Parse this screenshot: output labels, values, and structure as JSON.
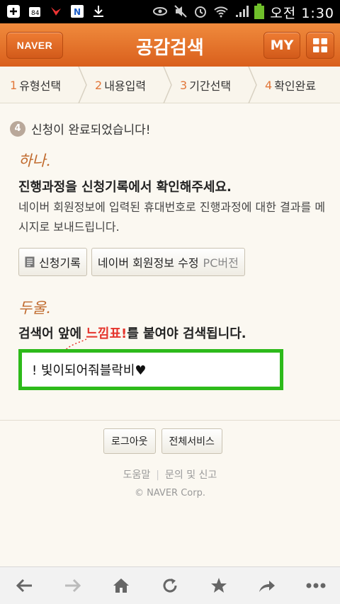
{
  "status_bar": {
    "time": "오전 1:30",
    "icons": [
      "add-icon",
      "kakao-icon",
      "app-icon",
      "naver-app-icon",
      "download-icon",
      "eye-icon",
      "mute-icon",
      "alarm-icon",
      "wifi-icon",
      "signal-icon",
      "battery-icon"
    ]
  },
  "header": {
    "naver_label": "NAVER",
    "title": "공감검색",
    "my_label": "MY"
  },
  "steps": [
    {
      "num": "1",
      "label": "유형선택"
    },
    {
      "num": "2",
      "label": "내용입력"
    },
    {
      "num": "3",
      "label": "기간선택"
    },
    {
      "num": "4",
      "label": "확인완료"
    }
  ],
  "content": {
    "done_num": "4",
    "done_text": "신청이 완료되었습니다!",
    "section1_script": "하나.",
    "section1_heading": "진행과정을 신청기록에서 확인해주세요.",
    "section1_desc": "네이버 회원정보에 입력된 휴대번호로 진행과정에 대한 결과를 메시지로 보내드립니다.",
    "btn_history": "신청기록",
    "btn_edit": "네이버 회원정보 수정",
    "btn_edit_sub": "PC버전",
    "section2_script": "두울.",
    "section2_pre": "검색어 앞에 ",
    "section2_highlight": "느낌표!",
    "section2_post": "를 붙여야 검색됩니다.",
    "search_example": "! 빛이되어줘블락비♥"
  },
  "footer": {
    "logout": "로그아웃",
    "all_services": "전체서비스",
    "help": "도움말",
    "contact": "문의 및 신고",
    "copyright": "© NAVER Corp."
  },
  "colors": {
    "header_orange": "#e56f26",
    "step_number": "#e2773a",
    "highlight_red": "#e5342c",
    "input_border_green": "#2dba1a"
  },
  "nav": [
    "back-icon",
    "forward-icon",
    "home-icon",
    "refresh-icon",
    "bookmark-icon",
    "share-icon",
    "more-icon"
  ]
}
